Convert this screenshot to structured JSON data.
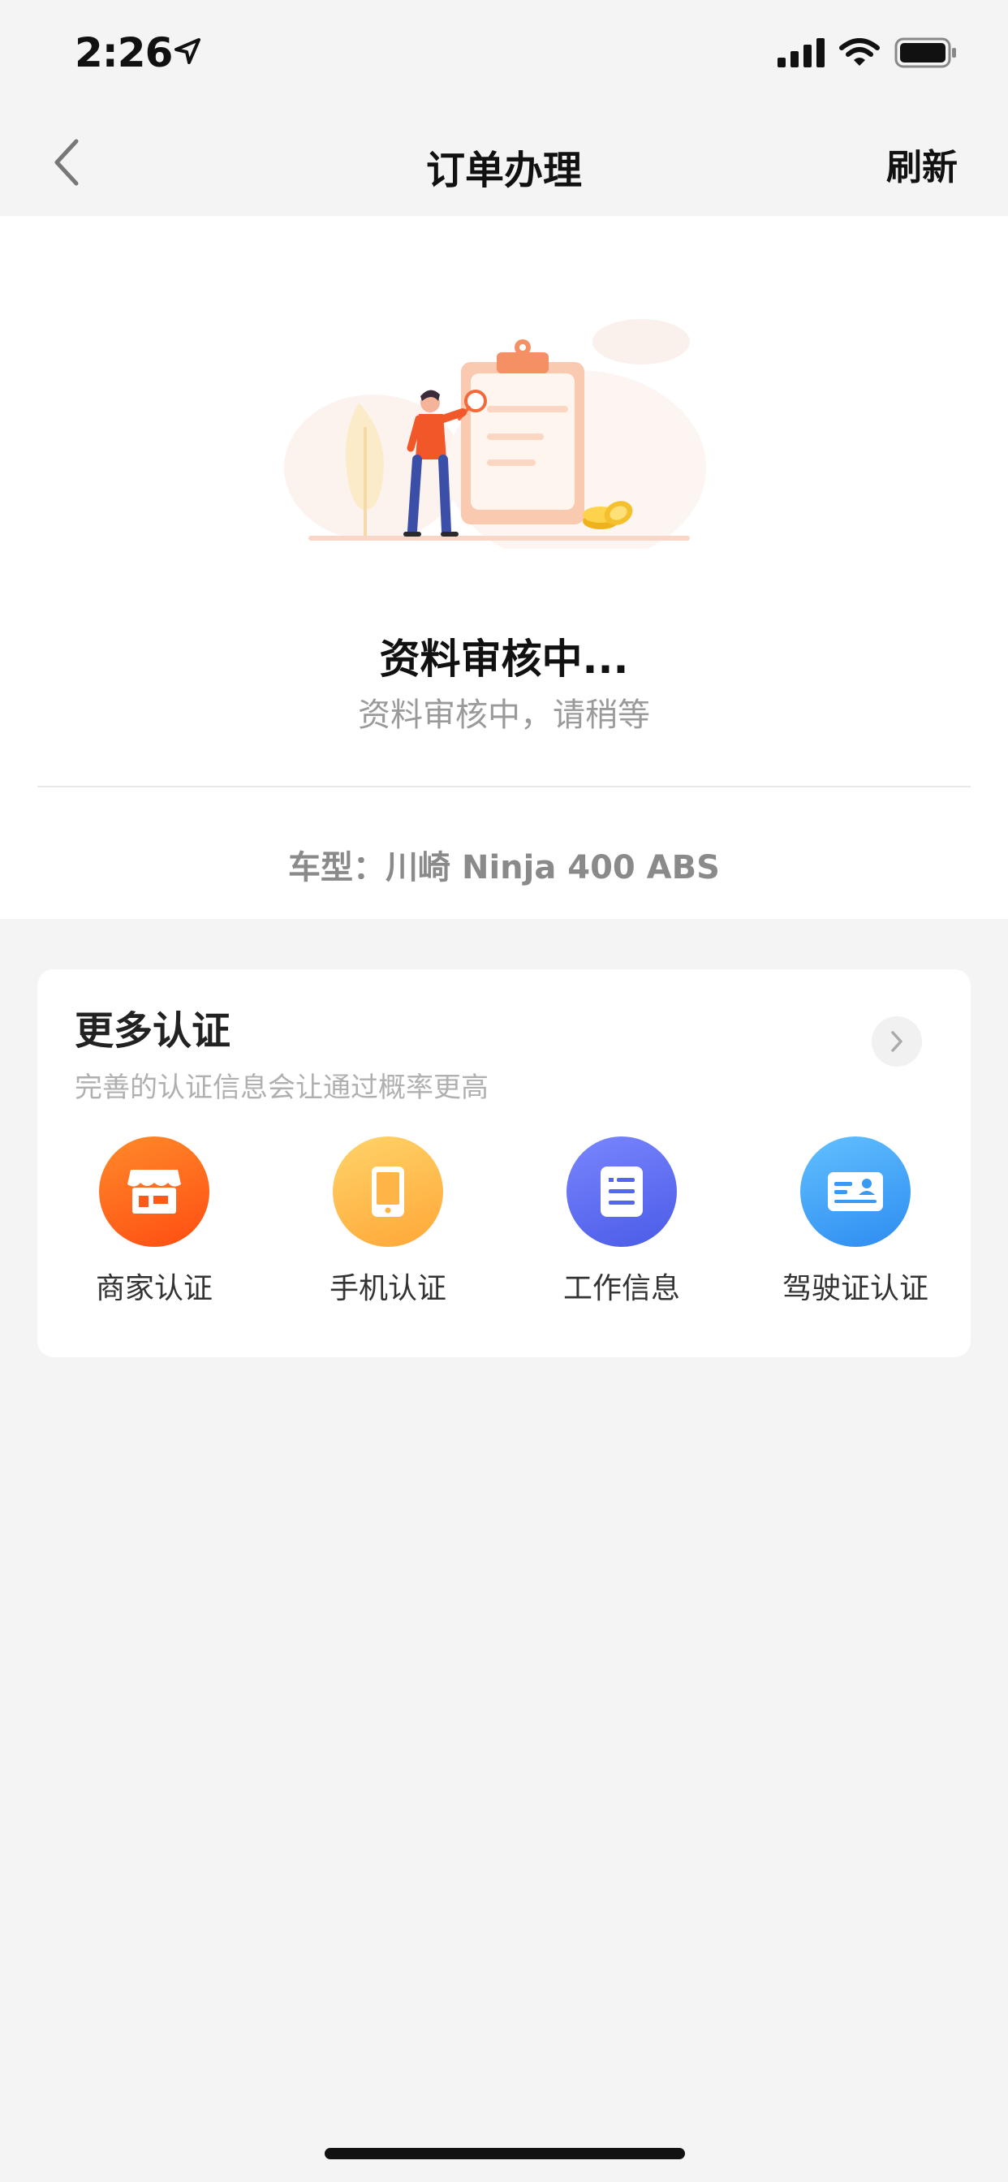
{
  "status_bar": {
    "time": "2:26",
    "icons": [
      "location-arrow-icon",
      "signal-icon",
      "wifi-icon",
      "battery-icon"
    ]
  },
  "nav": {
    "back_icon": "chevron-left-icon",
    "title": "订单办理",
    "refresh_label": "刷新"
  },
  "status": {
    "illustration": "document-review-illustration",
    "title": "资料审核中...",
    "subtitle": "资料审核中，请稍等",
    "car_model": "车型：川崎 Ninja 400 ABS"
  },
  "more_cert": {
    "title": "更多认证",
    "subtitle": "完善的认证信息会让通过概率更高",
    "arrow_icon": "chevron-right-icon",
    "items": [
      {
        "label": "商家认证",
        "icon": "store-icon",
        "color": "#ff6a1a"
      },
      {
        "label": "手机认证",
        "icon": "phone-icon",
        "color": "#ffb64a"
      },
      {
        "label": "工作信息",
        "icon": "document-icon",
        "color": "#5b6cf0"
      },
      {
        "label": "驾驶证认证",
        "icon": "id-card-icon",
        "color": "#3d9cf5"
      }
    ]
  },
  "colors": {
    "background": "#f4f4f4",
    "card": "#ffffff",
    "accent_orange": "#ff7a3d"
  }
}
